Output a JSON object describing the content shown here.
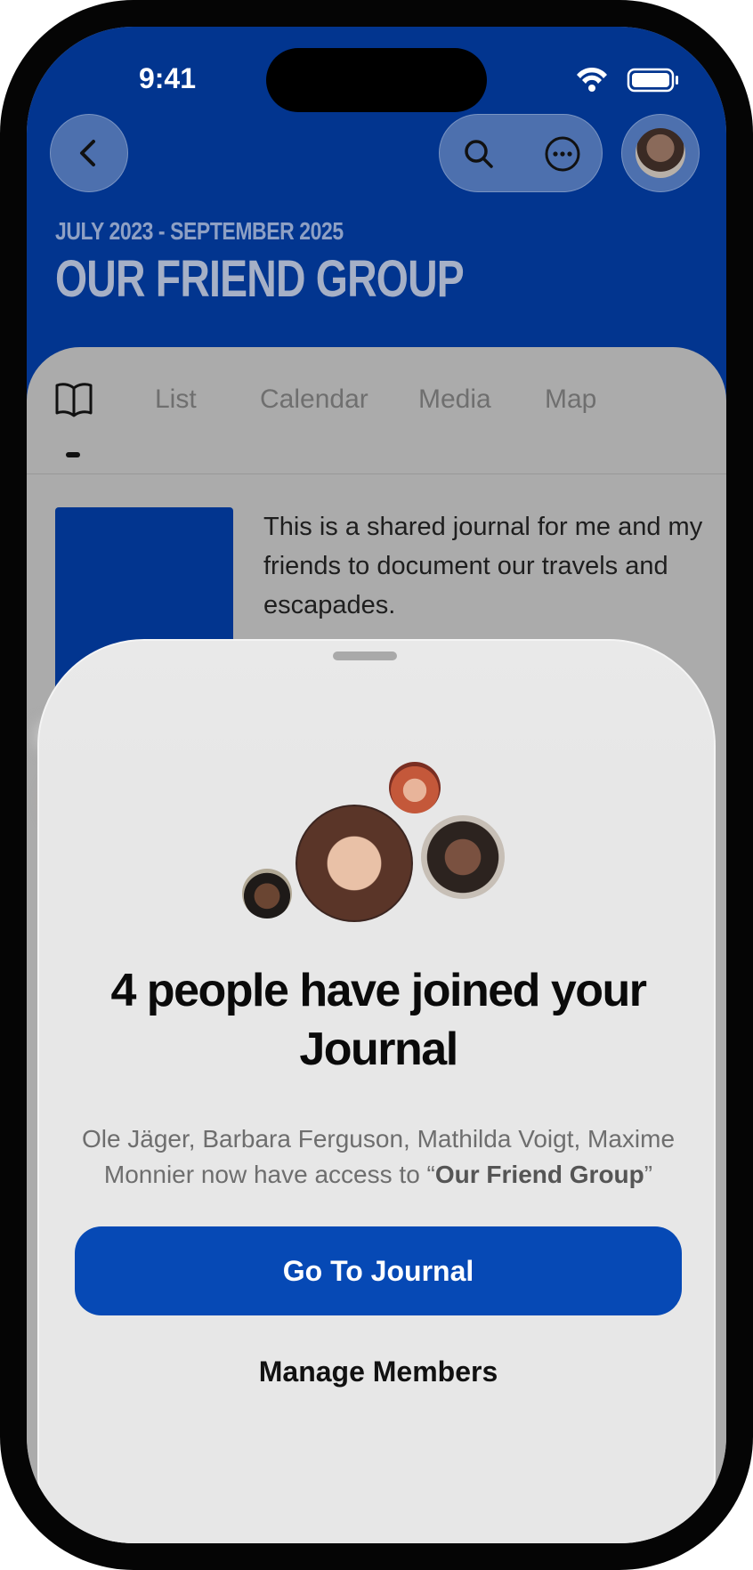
{
  "status_bar": {
    "time": "9:41"
  },
  "journal": {
    "date_range": "JULY 2023 - SEPTEMBER 2025",
    "title": "OUR FRIEND GROUP",
    "description": "This is a shared journal for me and my friends to document our travels and escapades."
  },
  "tabs": [
    {
      "icon": "book-icon",
      "label": ""
    },
    {
      "label": "List"
    },
    {
      "label": "Calendar"
    },
    {
      "label": "Media"
    },
    {
      "label": "Map"
    }
  ],
  "sheet": {
    "heading": "4 people have joined your Journal",
    "body_prefix": "Ole Jäger, Barbara Ferguson, Mathilda Voigt, Maxime Monnier now have access to “",
    "body_bold": "Our Friend Group",
    "body_suffix": "”",
    "primary_button": "Go To Journal",
    "secondary_button": "Manage Members"
  },
  "colors": {
    "header_blue": "#02358f",
    "button_blue": "#0649b5"
  },
  "icons": [
    "chevron-left-icon",
    "search-icon",
    "more-icon",
    "profile-avatar",
    "wifi-icon",
    "battery-icon",
    "book-icon"
  ]
}
